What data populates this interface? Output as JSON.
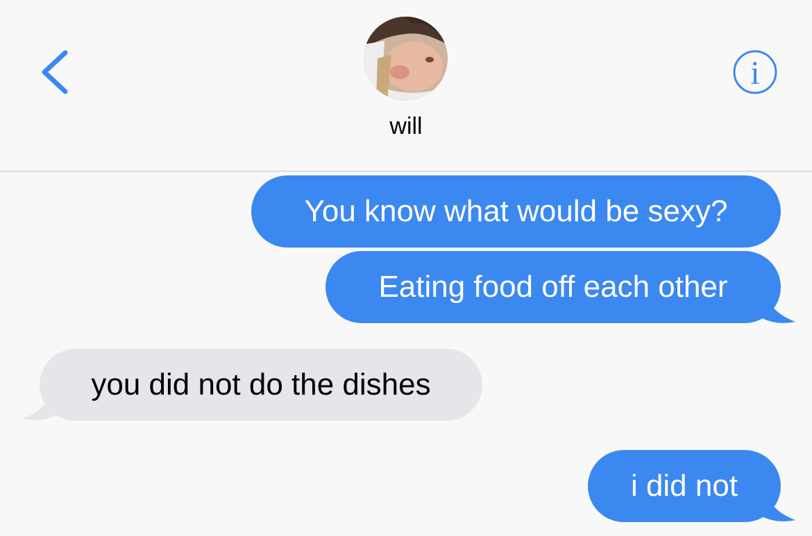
{
  "header": {
    "back_icon": "chevron-left-icon",
    "info_icon": "info-circle-icon",
    "contact_name": "will",
    "avatar_icon": "contact-photo"
  },
  "colors": {
    "accent": "#3b88f0",
    "outgoing_bubble": "#3b88f0",
    "incoming_bubble": "#e6e5ea",
    "background": "#f8f8f8"
  },
  "messages": [
    {
      "direction": "outgoing",
      "text": "You know what would be sexy?"
    },
    {
      "direction": "outgoing",
      "text": "Eating food off each other"
    },
    {
      "direction": "incoming",
      "text": "you did not do the dishes"
    },
    {
      "direction": "outgoing",
      "text": "i did not"
    }
  ]
}
